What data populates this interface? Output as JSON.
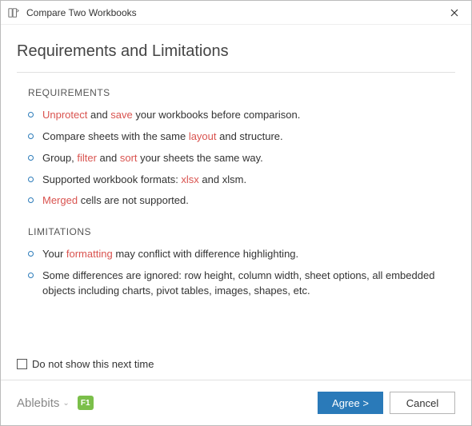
{
  "window": {
    "title": "Compare Two Workbooks"
  },
  "heading": "Requirements and Limitations",
  "sections": {
    "requirements": {
      "title": "REQUIREMENTS",
      "items": [
        {
          "pre": "",
          "hl1": "Unprotect",
          "mid1": " and ",
          "hl2": "save",
          "post": " your workbooks before comparison."
        },
        {
          "pre": "Compare sheets with the same ",
          "hl1": "layout",
          "mid1": " and structure.",
          "hl2": "",
          "post": ""
        },
        {
          "pre": "Group, ",
          "hl1": "filter",
          "mid1": " and ",
          "hl2": "sort",
          "post": " your sheets the same way."
        },
        {
          "pre": "Supported workbook formats: ",
          "hl1": "xlsx",
          "mid1": " and xlsm.",
          "hl2": "",
          "post": ""
        },
        {
          "pre": "",
          "hl1": "Merged",
          "mid1": " cells are not supported.",
          "hl2": "",
          "post": ""
        }
      ]
    },
    "limitations": {
      "title": "LIMITATIONS",
      "items": [
        {
          "pre": "Your ",
          "hl1": "formatting",
          "mid1": " may conflict with difference highlighting.",
          "hl2": "",
          "post": ""
        },
        {
          "pre": "Some differences are ignored: row height, column width, sheet options, all embedded objects including charts, pivot tables, images, shapes, etc.",
          "hl1": "",
          "mid1": "",
          "hl2": "",
          "post": ""
        }
      ]
    }
  },
  "options": {
    "dont_show": "Do not show this next time"
  },
  "footer": {
    "brand": "Ablebits",
    "help_key": "F1",
    "agree": "Agree >",
    "cancel": "Cancel"
  }
}
